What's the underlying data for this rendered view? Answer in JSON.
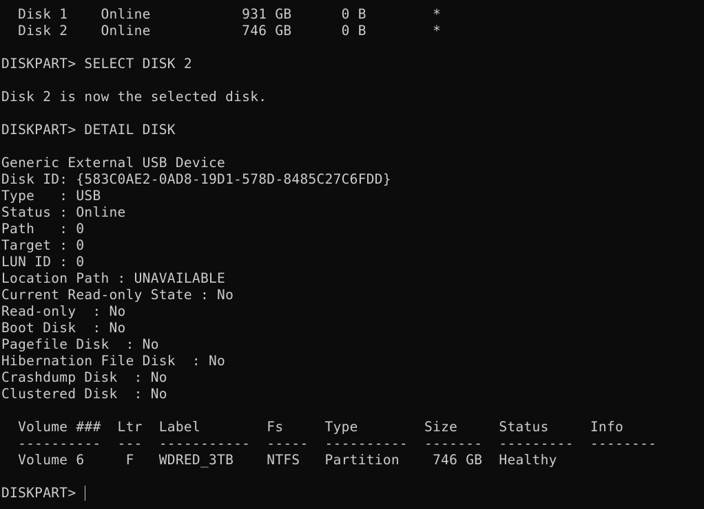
{
  "terminal": {
    "lines": [
      "  Disk 1    Online           931 GB      0 B        *",
      "  Disk 2    Online           746 GB      0 B        *",
      "",
      "DISKPART> SELECT DISK 2",
      "",
      "Disk 2 is now the selected disk.",
      "",
      "DISKPART> DETAIL DISK",
      "",
      "Generic External USB Device",
      "Disk ID: {583C0AE2-0AD8-19D1-578D-8485C27C6FDD}",
      "Type   : USB",
      "Status : Online",
      "Path   : 0",
      "Target : 0",
      "LUN ID : 0",
      "Location Path : UNAVAILABLE",
      "Current Read-only State : No",
      "Read-only  : No",
      "Boot Disk  : No",
      "Pagefile Disk  : No",
      "Hibernation File Disk  : No",
      "Crashdump Disk  : No",
      "Clustered Disk  : No",
      "",
      "  Volume ###  Ltr  Label        Fs     Type        Size     Status     Info",
      "  ----------  ---  -----------  -----  ----------  -------  ---------  --------",
      "  Volume 6     F   WDRED_3TB    NTFS   Partition    746 GB  Healthy",
      ""
    ],
    "prompt": "DISKPART> "
  }
}
